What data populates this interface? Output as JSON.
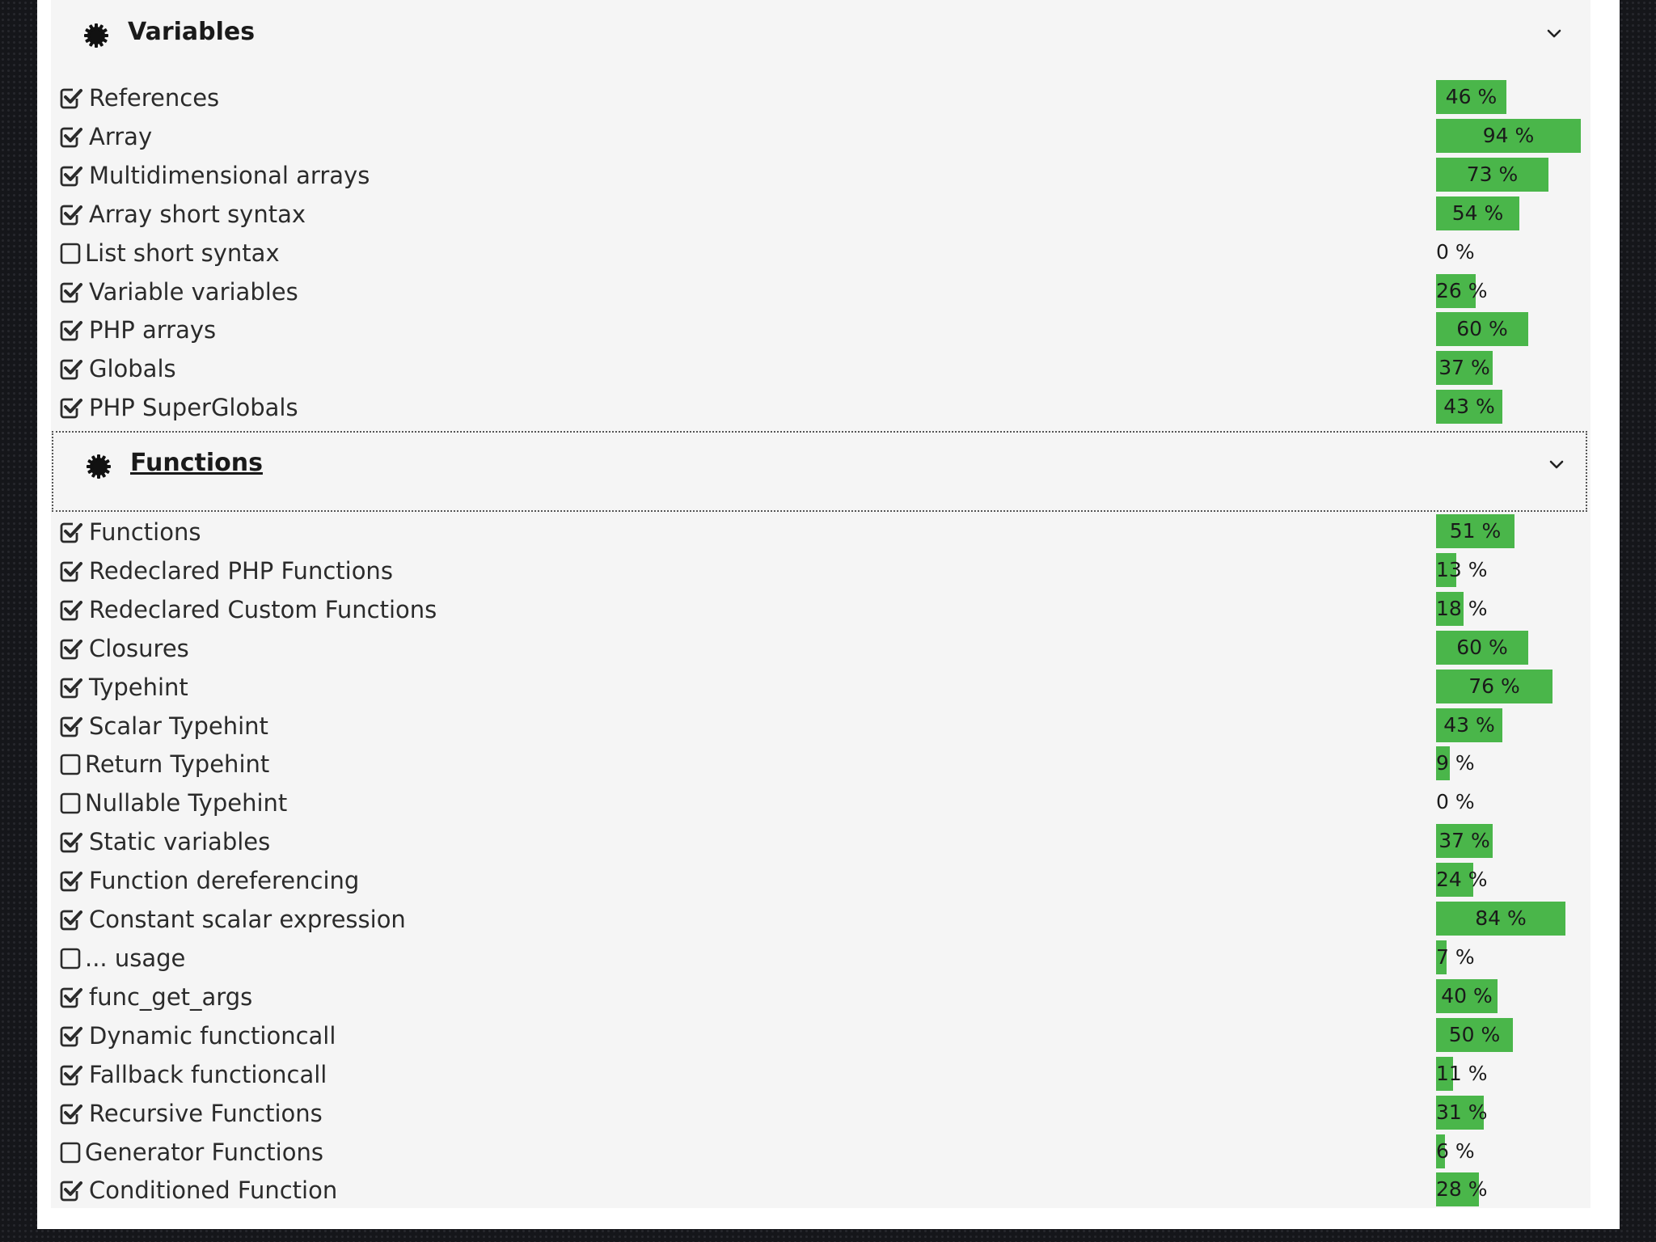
{
  "sections": [
    {
      "title": "Variables",
      "icon": "gear-icon",
      "expanded": true,
      "items": [
        {
          "label": "References",
          "checked": true,
          "pct": 46,
          "pct_text": "46 %"
        },
        {
          "label": "Array",
          "checked": true,
          "pct": 94,
          "pct_text": "94 %"
        },
        {
          "label": "Multidimensional arrays",
          "checked": true,
          "pct": 73,
          "pct_text": "73 %"
        },
        {
          "label": "Array short syntax",
          "checked": true,
          "pct": 54,
          "pct_text": "54 %"
        },
        {
          "label": "List short syntax",
          "checked": false,
          "pct": 0,
          "pct_text": "0 %"
        },
        {
          "label": "Variable variables",
          "checked": true,
          "pct": 26,
          "pct_text": "26 %"
        },
        {
          "label": "PHP arrays",
          "checked": true,
          "pct": 60,
          "pct_text": "60 %"
        },
        {
          "label": "Globals",
          "checked": true,
          "pct": 37,
          "pct_text": "37 %"
        },
        {
          "label": "PHP SuperGlobals",
          "checked": true,
          "pct": 43,
          "pct_text": "43 %"
        }
      ]
    },
    {
      "title": "Functions",
      "icon": "gear-icon",
      "expanded": true,
      "focused": true,
      "items": [
        {
          "label": "Functions",
          "checked": true,
          "pct": 51,
          "pct_text": "51 %"
        },
        {
          "label": "Redeclared PHP Functions",
          "checked": true,
          "pct": 13,
          "pct_text": "13 %"
        },
        {
          "label": "Redeclared Custom Functions",
          "checked": true,
          "pct": 18,
          "pct_text": "18 %"
        },
        {
          "label": "Closures",
          "checked": true,
          "pct": 60,
          "pct_text": "60 %"
        },
        {
          "label": "Typehint",
          "checked": true,
          "pct": 76,
          "pct_text": "76 %"
        },
        {
          "label": "Scalar Typehint",
          "checked": true,
          "pct": 43,
          "pct_text": "43 %"
        },
        {
          "label": "Return Typehint",
          "checked": false,
          "pct": 9,
          "pct_text": "9 %"
        },
        {
          "label": "Nullable Typehint",
          "checked": false,
          "pct": 0,
          "pct_text": "0 %"
        },
        {
          "label": "Static variables",
          "checked": true,
          "pct": 37,
          "pct_text": "37 %"
        },
        {
          "label": "Function dereferencing",
          "checked": true,
          "pct": 24,
          "pct_text": "24 %"
        },
        {
          "label": "Constant scalar expression",
          "checked": true,
          "pct": 84,
          "pct_text": "84 %"
        },
        {
          "label": "... usage",
          "checked": false,
          "pct": 7,
          "pct_text": "7 %"
        },
        {
          "label": "func_get_args",
          "checked": true,
          "pct": 40,
          "pct_text": "40 %"
        },
        {
          "label": "Dynamic functioncall",
          "checked": true,
          "pct": 50,
          "pct_text": "50 %"
        },
        {
          "label": "Fallback functioncall",
          "checked": true,
          "pct": 11,
          "pct_text": "11 %"
        },
        {
          "label": "Recursive Functions",
          "checked": true,
          "pct": 31,
          "pct_text": "31 %"
        },
        {
          "label": "Generator Functions",
          "checked": false,
          "pct": 6,
          "pct_text": "6 %"
        },
        {
          "label": "Conditioned Function",
          "checked": true,
          "pct": 28,
          "pct_text": "28 %"
        }
      ]
    }
  ],
  "colors": {
    "bar": "#4ab64a",
    "panel": "#f5f5f5"
  }
}
